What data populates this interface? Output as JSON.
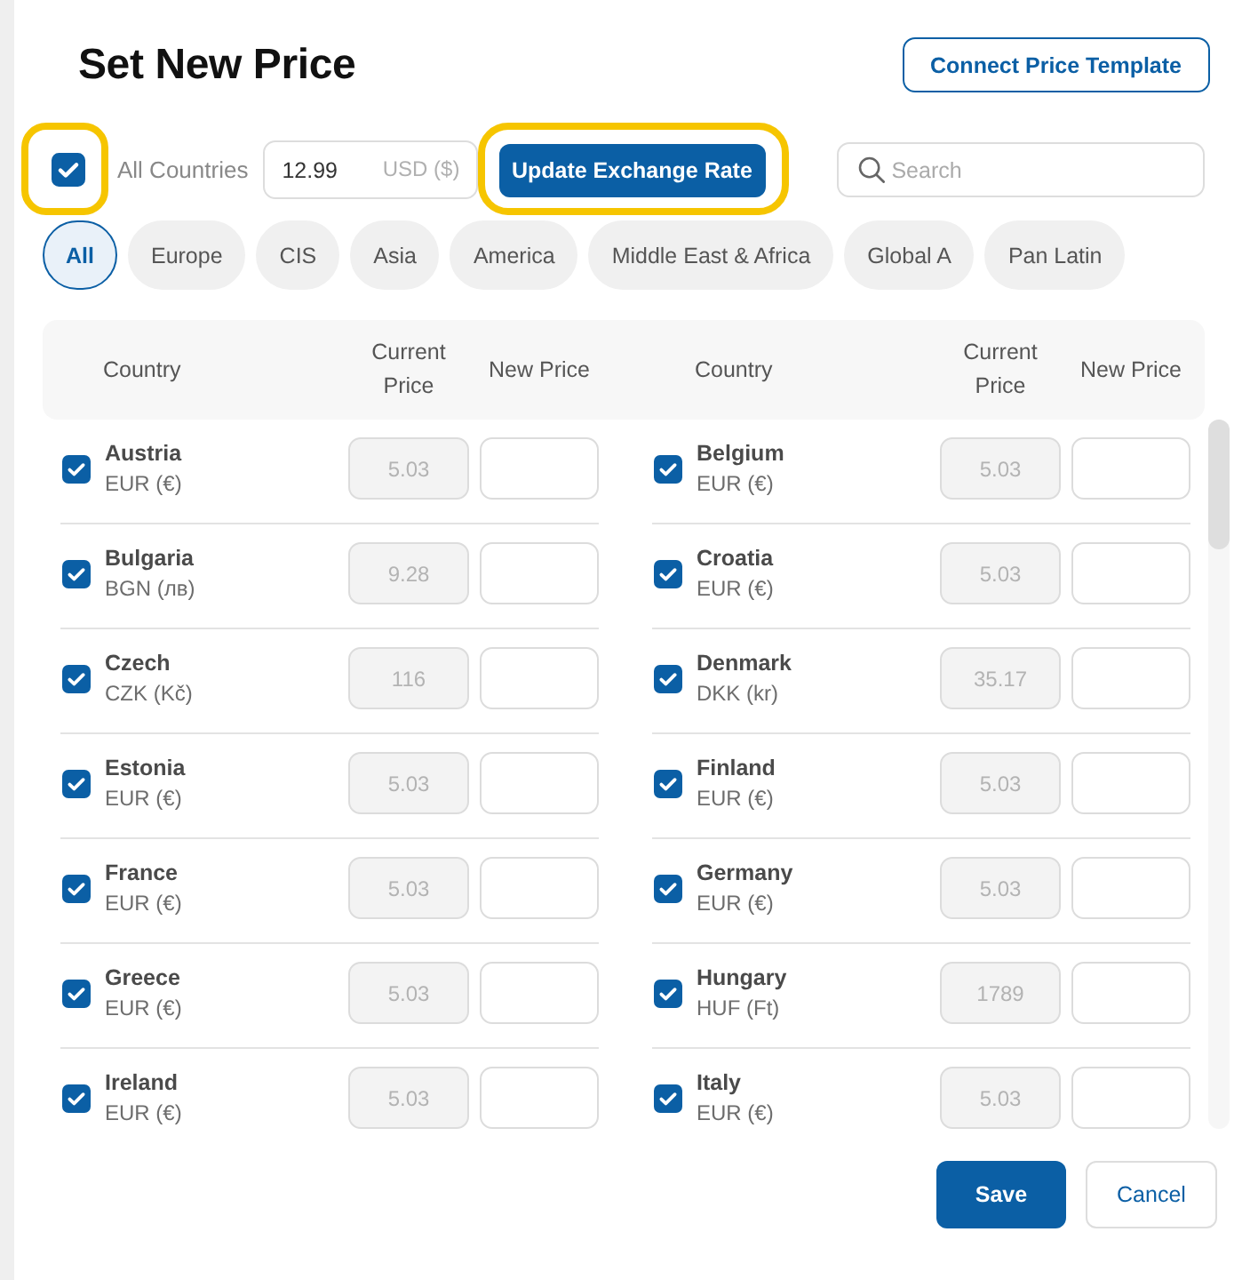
{
  "title": "Set New Price",
  "connect_button": {
    "label": "Connect Price Template"
  },
  "all_countries": {
    "label": "All Countries",
    "checked": true,
    "highlighted": true
  },
  "base_price": {
    "value": "12.99",
    "currency": "USD ($)"
  },
  "update_button": {
    "label": "Update Exchange Rate",
    "highlighted": true
  },
  "search": {
    "placeholder": "Search"
  },
  "regions": [
    {
      "label": "All",
      "selected": true
    },
    {
      "label": "Europe",
      "selected": false
    },
    {
      "label": "CIS",
      "selected": false
    },
    {
      "label": "Asia",
      "selected": false
    },
    {
      "label": "America",
      "selected": false
    },
    {
      "label": "Middle East & Africa",
      "selected": false
    },
    {
      "label": "Global A",
      "selected": false
    },
    {
      "label": "Pan Latin",
      "selected": false
    }
  ],
  "table": {
    "columns": [
      "Country",
      "Current Price",
      "New Price",
      "Country",
      "Current Price",
      "New Price"
    ],
    "rows": [
      {
        "country": "Austria",
        "currency": "EUR (€)",
        "current_price": "5.03",
        "checked": true
      },
      {
        "country": "Belgium",
        "currency": "EUR (€)",
        "current_price": "5.03",
        "checked": true
      },
      {
        "country": "Bulgaria",
        "currency": "BGN (лв)",
        "current_price": "9.28",
        "checked": true
      },
      {
        "country": "Croatia",
        "currency": "EUR (€)",
        "current_price": "5.03",
        "checked": true
      },
      {
        "country": "Czech",
        "currency": "CZK (Kč)",
        "current_price": "116",
        "checked": true
      },
      {
        "country": "Denmark",
        "currency": "DKK (kr)",
        "current_price": "35.17",
        "checked": true
      },
      {
        "country": "Estonia",
        "currency": "EUR (€)",
        "current_price": "5.03",
        "checked": true
      },
      {
        "country": "Finland",
        "currency": "EUR (€)",
        "current_price": "5.03",
        "checked": true
      },
      {
        "country": "France",
        "currency": "EUR (€)",
        "current_price": "5.03",
        "checked": true
      },
      {
        "country": "Germany",
        "currency": "EUR (€)",
        "current_price": "5.03",
        "checked": true
      },
      {
        "country": "Greece",
        "currency": "EUR (€)",
        "current_price": "5.03",
        "checked": true
      },
      {
        "country": "Hungary",
        "currency": "HUF (Ft)",
        "current_price": "1789",
        "checked": true
      },
      {
        "country": "Ireland",
        "currency": "EUR (€)",
        "current_price": "5.03",
        "checked": true
      },
      {
        "country": "Italy",
        "currency": "EUR (€)",
        "current_price": "5.03",
        "checked": true
      }
    ]
  },
  "buttons": [
    {
      "label": "Save",
      "kind": "primary"
    },
    {
      "label": "Cancel",
      "kind": "secondary"
    }
  ]
}
